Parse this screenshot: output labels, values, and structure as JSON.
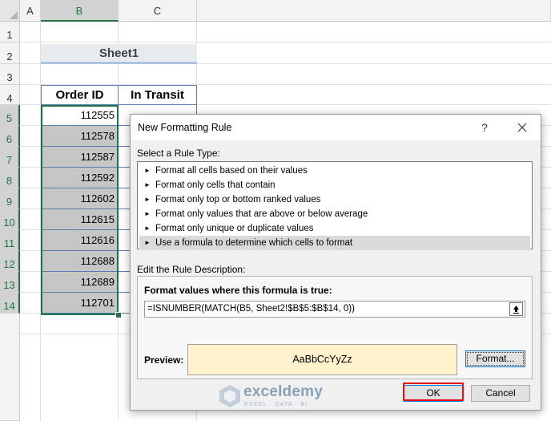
{
  "spreadsheet": {
    "columns": [
      "A",
      "B",
      "C"
    ],
    "rows": [
      "1",
      "2",
      "3",
      "4",
      "5",
      "6",
      "7",
      "8",
      "9",
      "10",
      "11",
      "12",
      "13",
      "14"
    ],
    "title": "Sheet1",
    "headers": {
      "order_id": "Order ID",
      "in_transit": "In Transit"
    },
    "order_ids": [
      "112555",
      "112578",
      "112587",
      "112592",
      "112602",
      "112615",
      "112616",
      "112688",
      "112689",
      "112701"
    ]
  },
  "dialog": {
    "title": "New Formatting Rule",
    "help": "?",
    "rule_type_label": "Select a Rule Type:",
    "rule_types": [
      "Format all cells based on their values",
      "Format only cells that contain",
      "Format only top or bottom ranked values",
      "Format only values that are above or below average",
      "Format only unique or duplicate values",
      "Use a formula to determine which cells to format"
    ],
    "selected_rule_index": 5,
    "description_label": "Edit the Rule Description:",
    "formula_label": "Format values where this formula is true:",
    "formula_value": "=ISNUMBER(MATCH(B5, Sheet2!$B$5:$B$14, 0))",
    "preview_label": "Preview:",
    "preview_text": "AaBbCcYyZz",
    "format_button": "Format...",
    "ok_button": "OK",
    "cancel_button": "Cancel"
  },
  "watermark": {
    "name": "exceldemy",
    "tagline": "EXCEL · DATA · BI"
  },
  "colors": {
    "excel_green": "#217346",
    "table_border": "#5a7fae",
    "preview_fill": "#fff2cc",
    "highlight_red": "#e8111b"
  }
}
